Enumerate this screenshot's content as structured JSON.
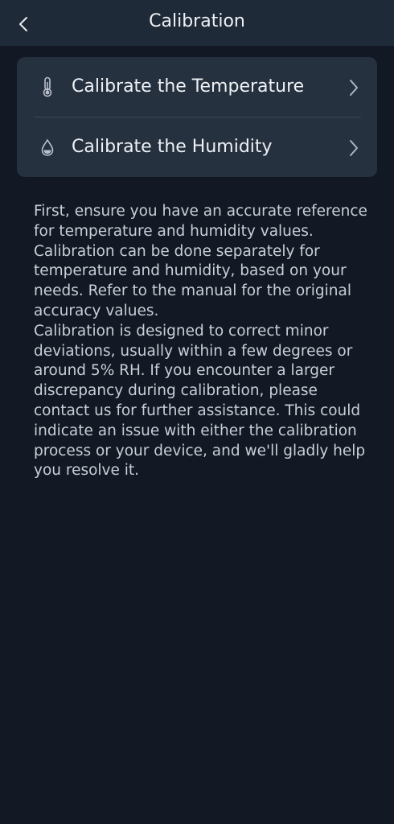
{
  "header": {
    "title": "Calibration",
    "back_icon": "chevron-left-icon"
  },
  "menu": {
    "items": [
      {
        "label": "Calibrate the Temperature",
        "icon": "thermometer-icon",
        "chevron": "chevron-right-icon"
      },
      {
        "label": "Calibrate the Humidity",
        "icon": "water-drop-icon",
        "chevron": "chevron-right-icon"
      }
    ]
  },
  "description": {
    "paragraph1": "First, ensure you have an accurate reference for temperature and humidity values. Calibration can be done separately for temperature and humidity, based on your needs. Refer to the manual for the original accuracy values.",
    "paragraph2": "Calibration is designed to correct minor deviations, usually within a few degrees or around 5% RH. If you encounter a larger discrepancy during calibration, please contact us for further assistance. This could indicate an issue with either the calibration process or your device, and we'll gladly help you resolve it."
  },
  "colors": {
    "background": "#121924",
    "header": "#1f2a38",
    "card": "#263140",
    "text": "#eef1f5",
    "muted_text": "#c9ced6"
  }
}
